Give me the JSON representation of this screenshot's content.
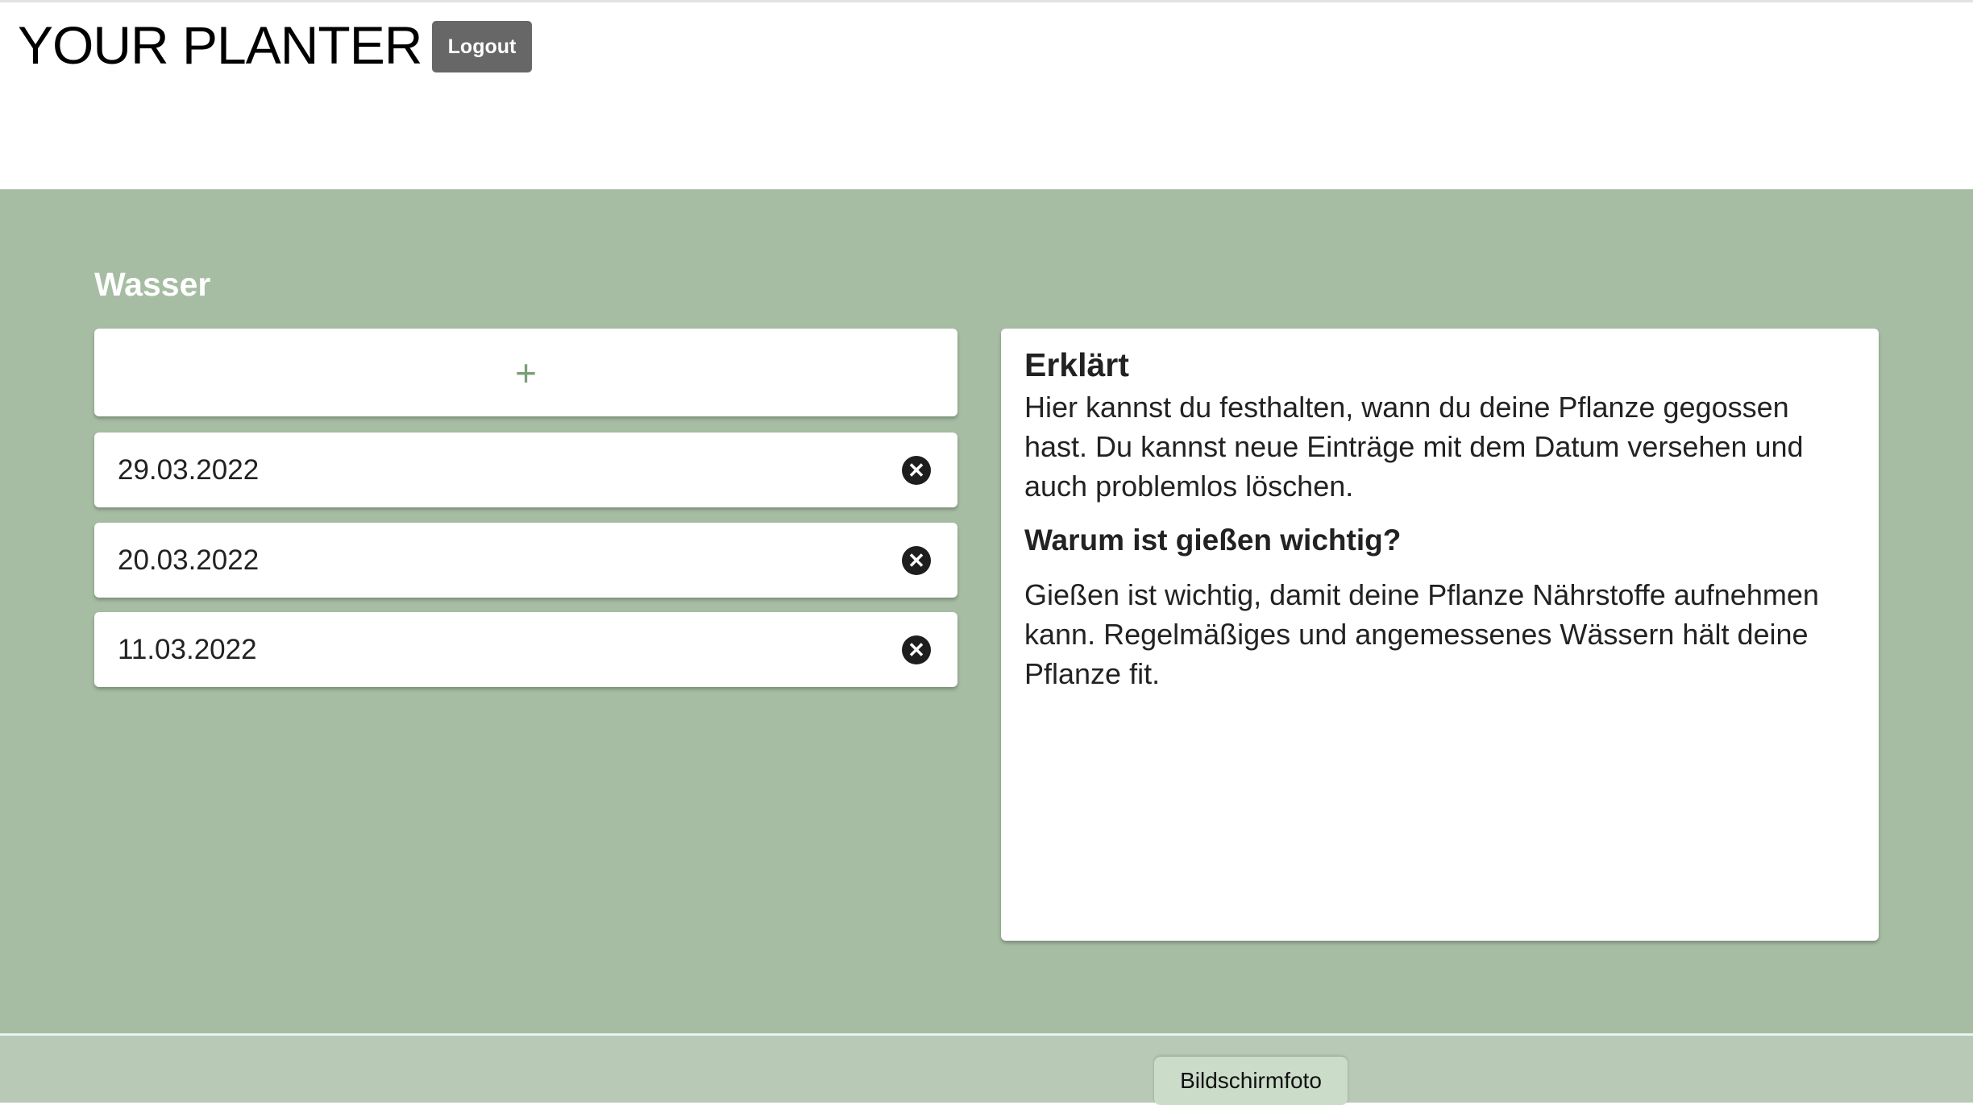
{
  "header": {
    "title": "YOUR PLANTER",
    "logout_label": "Logout"
  },
  "section": {
    "title": "Wasser",
    "add_label": "+"
  },
  "entries": [
    {
      "date": "29.03.2022"
    },
    {
      "date": "20.03.2022"
    },
    {
      "date": "11.03.2022"
    }
  ],
  "delete_icon": "✕",
  "info": {
    "heading": "Erklärt",
    "intro": "Hier kannst du festhalten, wann du deine Pflanze gegossen hast. Du kannst neue Einträge mit dem Datum versehen und auch problemlos löschen.",
    "subheading": "Warum ist gießen wichtig?",
    "body": "Gießen ist wichtig, damit deine Pflanze Nährstoffe aufnehmen kann. Regelmäßiges und angemessenes Wässern hält deine Pflanze fit."
  },
  "footer": {
    "screenshot_label": "Bildschirmfoto"
  },
  "colors": {
    "background": "#a6bda3",
    "accent": "#7a9e77",
    "logout": "#676767"
  }
}
